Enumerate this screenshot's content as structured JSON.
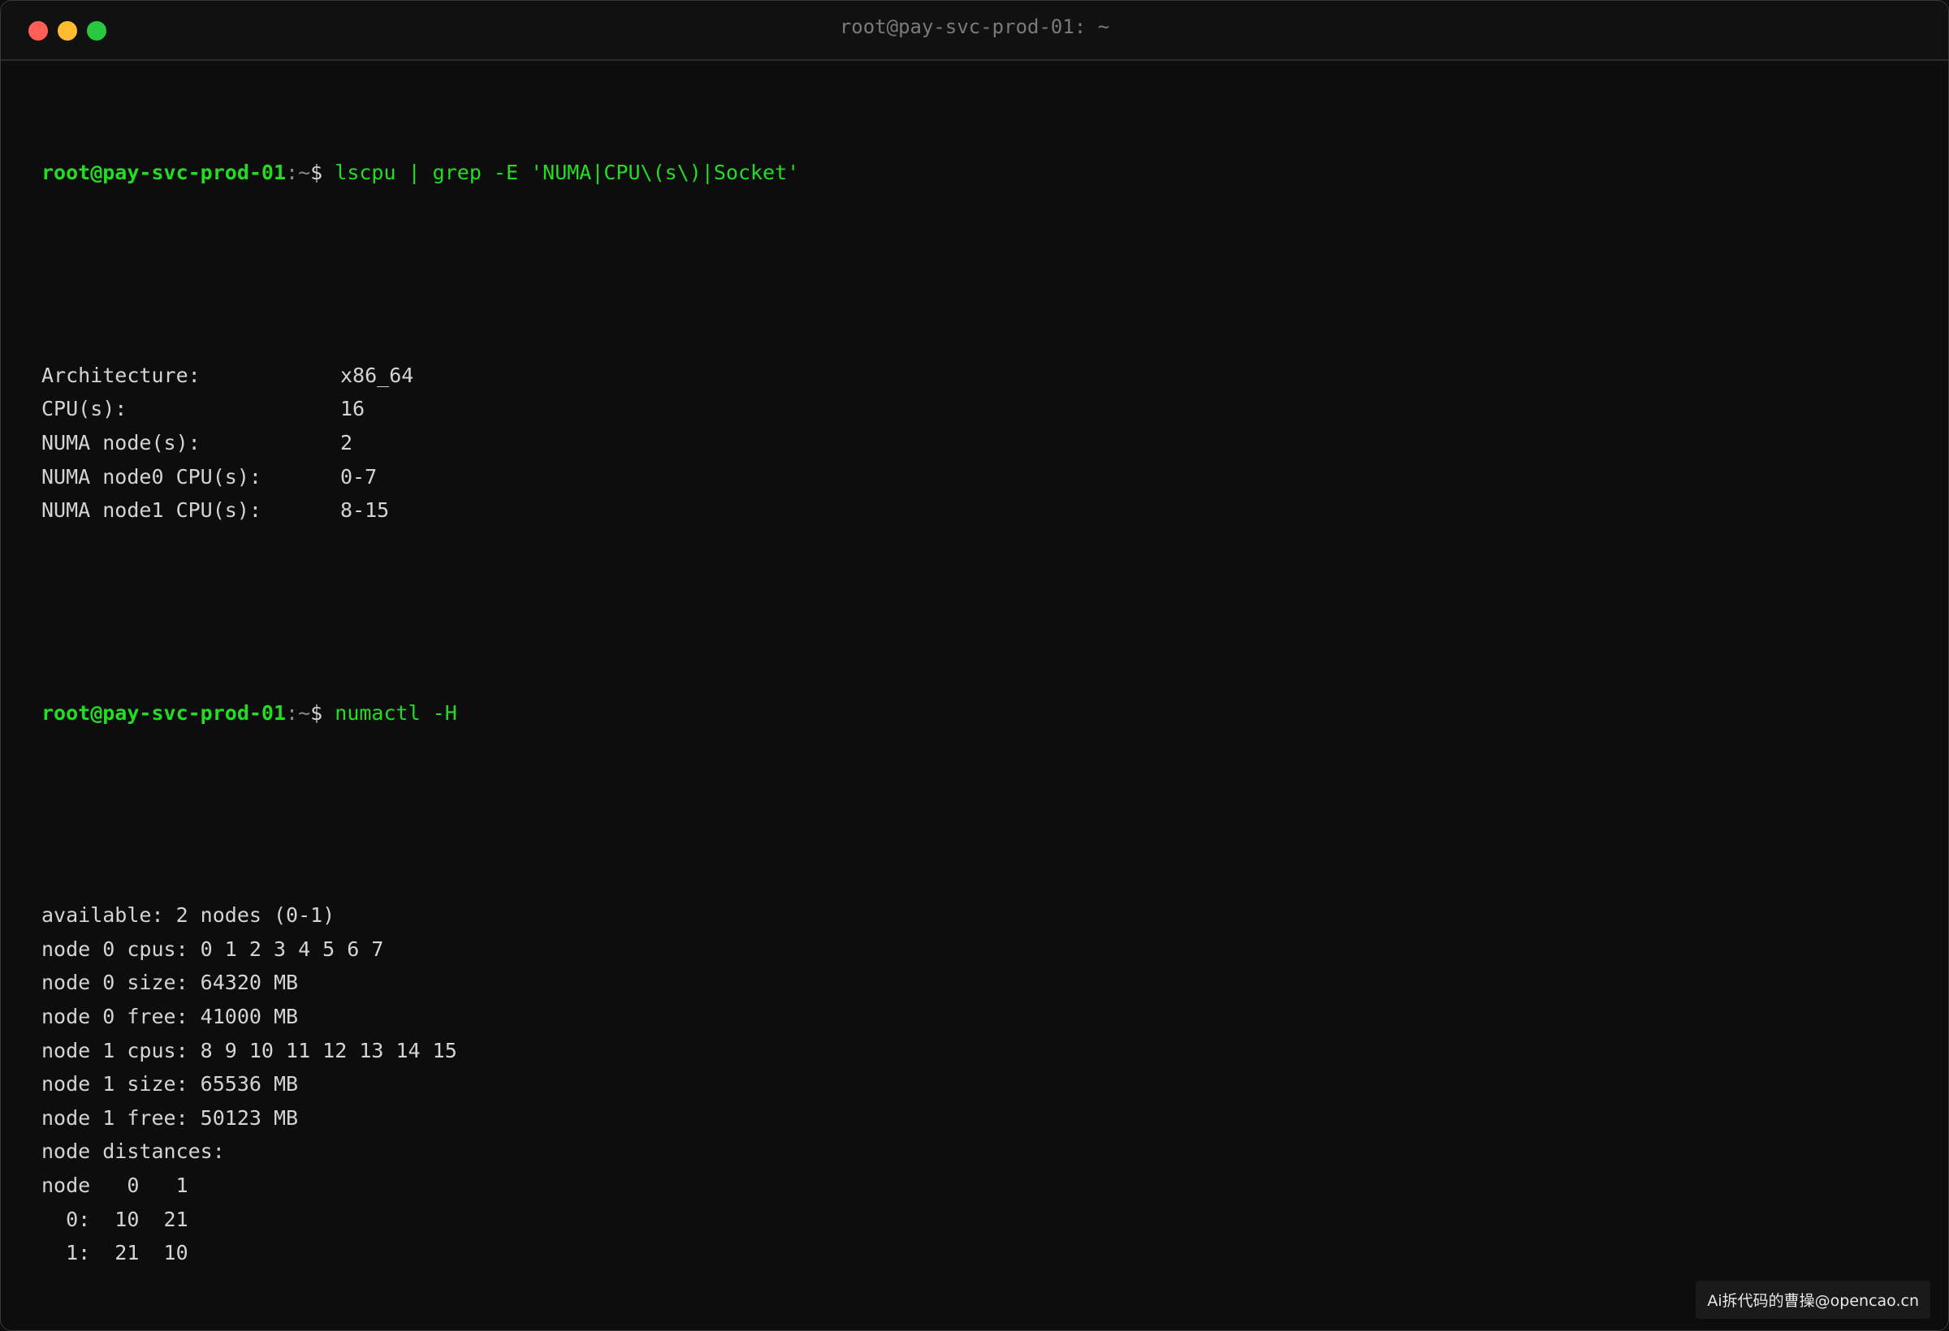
{
  "window": {
    "title": "root@pay-svc-prod-01: ~",
    "traffic_lights": {
      "close_color": "#ff5f57",
      "minimize_color": "#febc2e",
      "maximize_color": "#28c840"
    }
  },
  "prompt": {
    "user_host": "root@pay-svc-prod-01",
    "sep": ":",
    "path": "~",
    "dollar": "$ "
  },
  "session": {
    "cmd1": "lscpu | grep -E 'NUMA|CPU\\(s\\)|Socket'",
    "lscpu": [
      {
        "key": "Architecture:",
        "value": "x86_64"
      },
      {
        "key": "CPU(s):",
        "value": "16"
      },
      {
        "key": "NUMA node(s):",
        "value": "2"
      },
      {
        "key": "NUMA node0 CPU(s):",
        "value": "0-7"
      },
      {
        "key": "NUMA node1 CPU(s):",
        "value": "8-15"
      }
    ],
    "cmd2": "numactl -H",
    "numactl": [
      "available: 2 nodes (0-1)",
      "node 0 cpus: 0 1 2 3 4 5 6 7",
      "node 0 size: 64320 MB",
      "node 0 free: 41000 MB",
      "node 1 cpus: 8 9 10 11 12 13 14 15",
      "node 1 size: 65536 MB",
      "node 1 free: 50123 MB",
      "node distances:",
      "node   0   1",
      "  0:  10  21",
      "  1:  21  10"
    ]
  },
  "watermark": "Ai拆代码的曹操@opencao.cn",
  "colors": {
    "background": "#0d0d0d",
    "prompt_green": "#22dd22",
    "output_text": "#d4d4d4"
  }
}
